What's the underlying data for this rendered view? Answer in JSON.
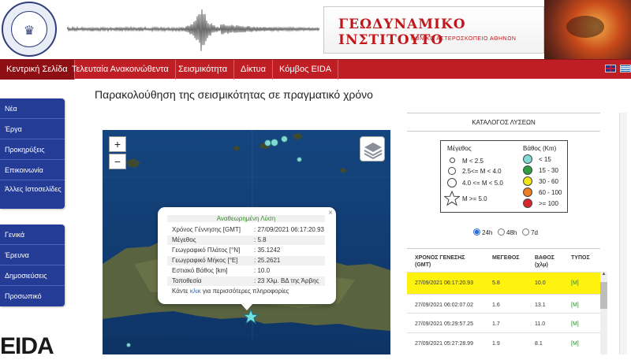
{
  "header": {
    "logo_text": "OBSERVATORY · ATHENS",
    "brand_title": "ΓΕΩΔΥΝΑΜΙΚΟ ΙΝΣΤΙΤΟΥΤΟ",
    "brand_subtitle": "ΕΘΝΙΚΟ ΑΣΤΕΡΟΣΚΟΠΕΙΟ ΑΘΗΝΩΝ"
  },
  "nav": {
    "items": [
      "Κεντρική Σελίδα",
      "Τελευταία Ανακοινώθεντα",
      "Σεισμικότητα",
      "Δίκτυα",
      "Κόμβος EIDA"
    ],
    "active_index": 0,
    "languages": [
      "uk-flag",
      "gr-flag"
    ]
  },
  "sidebar": {
    "group1": [
      "Νέα",
      "Έργα",
      "Προκηρύξεις",
      "Επικοινωνία",
      "Άλλες Ιστοσελίδες"
    ],
    "group2": [
      "Γενικά",
      "Έρευνα",
      "Δημοσιεύσεις",
      "Προσωπικό"
    ],
    "eida_logo": "EIDA"
  },
  "main": {
    "title": "Παρακολούθηση της σεισμικότητας σε πραγματικό χρόνο"
  },
  "map": {
    "zoom_in": "+",
    "zoom_out": "−",
    "popup": {
      "heading": "Αναθεωρημένη Λύση",
      "rows": [
        {
          "label": "Χρόνος Γέννησης [GMT]",
          "value": ": 27/09/2021 06:17:20.93"
        },
        {
          "label": "Μέγεθος",
          "value": ": 5.8"
        },
        {
          "label": "Γεωγραφικό Πλάτος [°N]",
          "value": ": 35.1242"
        },
        {
          "label": "Γεωγραφικό Μήκος [°E]",
          "value": ": 25.2621"
        },
        {
          "label": "Εστιακό Βάθος [km]",
          "value": ": 10.0"
        },
        {
          "label": "Τοποθεσία",
          "value": ": 23 Χλμ. ΒΔ της Άρβης"
        }
      ],
      "footer_before": "Κάντε",
      "footer_link": "κλικ",
      "footer_after": "για περισσότερες πληροφορίες",
      "close": "×"
    }
  },
  "catalog": {
    "title": "ΚΑΤΑΛΟΓΟΣ ΛΥΣΕΩΝ",
    "legend": {
      "magnitude_heading": "Μέγεθος",
      "depth_heading": "Βάθος (Km)",
      "magnitude_items": [
        "M < 2.5",
        "2.5<= M < 4.0",
        "4.0 <= M < 5.0",
        "M >= 5.0"
      ],
      "depth_items": [
        {
          "label": "< 15",
          "color": "#7fd9d6"
        },
        {
          "label": "15 - 30",
          "color": "#2f9e3f"
        },
        {
          "label": "30 - 60",
          "color": "#f2e51a"
        },
        {
          "label": "60 - 100",
          "color": "#ef7d22"
        },
        {
          "label": ">= 100",
          "color": "#d9262c"
        }
      ]
    },
    "ranges": [
      {
        "label": "24h",
        "selected": true
      },
      {
        "label": "48h",
        "selected": false
      },
      {
        "label": "7d",
        "selected": false
      }
    ],
    "columns": [
      "ΧΡΟΝΟΣ ΓΕΝΕΣΗΣ (GMT)",
      "ΜΕΓΕΘΟΣ",
      "ΒΑΘΟΣ (χλμ)",
      "ΤΥΠΟΣ"
    ],
    "rows": [
      {
        "time": "27/09/2021 06:17:20.93",
        "mag": "5.8",
        "depth": "10.0",
        "type": "[M]",
        "highlight": true
      },
      {
        "time": "27/09/2021 06:02:07.02",
        "mag": "1.6",
        "depth": "13.1",
        "type": "[M]",
        "highlight": false
      },
      {
        "time": "27/09/2021 05:29:57.25",
        "mag": "1.7",
        "depth": "11.0",
        "type": "[M]",
        "highlight": false
      },
      {
        "time": "27/09/2021 05:27:28.99",
        "mag": "1.9",
        "depth": "8.1",
        "type": "[M]",
        "highlight": false
      }
    ]
  }
}
